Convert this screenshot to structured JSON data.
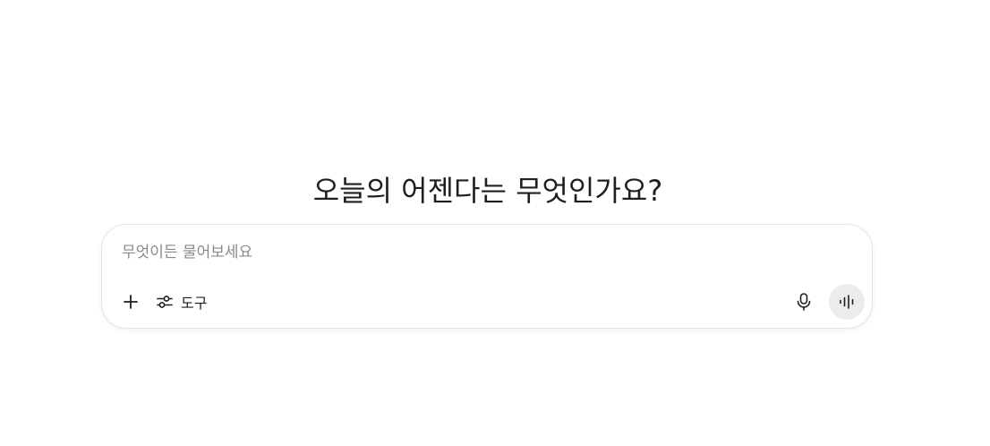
{
  "heading": "오늘의 어젠다는 무엇인가요?",
  "composer": {
    "placeholder": "무엇이든 물어보세요",
    "value": "",
    "add_icon": "plus-icon",
    "tools_icon": "sliders-icon",
    "tools_label": "도구",
    "mic_icon": "microphone-icon",
    "voice_icon": "audio-waveform-icon"
  },
  "colors": {
    "background": "#ffffff",
    "text": "#1f1f1f",
    "placeholder": "#8a8a8a",
    "border": "#e3e3e3",
    "voice_button_bg": "#ececec"
  }
}
